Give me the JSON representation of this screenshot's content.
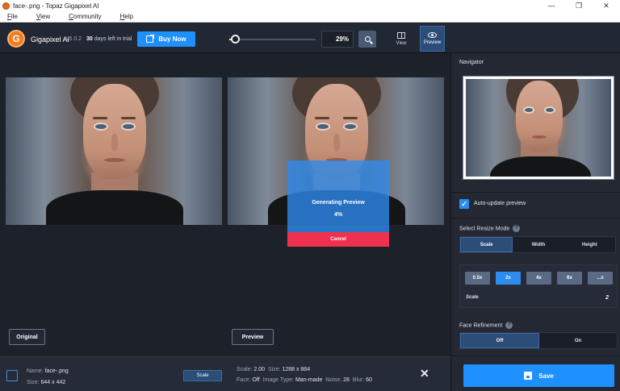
{
  "window": {
    "title": "face-.png - Topaz Gigapixel AI",
    "minimize": "—",
    "maximize": "❐",
    "close": "✕"
  },
  "menu": [
    "File",
    "View",
    "Community",
    "Help"
  ],
  "topbar": {
    "app_name": "Gigapixel AI",
    "version": "v5.0.2",
    "trial_days": "30",
    "trial_text": "days left in trial",
    "buy_label": "Buy Now",
    "zoom_value": "29%",
    "zoom_level": 0.29,
    "view_label": "View",
    "preview_label": "Preview"
  },
  "main": {
    "generating_label": "Generating Preview",
    "progress_text": "4%",
    "cancel_label": "Cancel",
    "original_label": "Original",
    "preview_label": "Preview"
  },
  "bottom": {
    "name_label": "Name:",
    "name_value": "face-.png",
    "size_label": "Size:",
    "size_value": "644 x 442",
    "mode_chip": "Scale",
    "scale_label": "Scale:",
    "scale_value": "2.00",
    "out_size_label": "Size:",
    "out_size_value": "1288 x 884",
    "face_label": "Face:",
    "face_value": "Off",
    "image_type_label": "Image Type:",
    "image_type_value": "Man-made",
    "noise_label": "Noise:",
    "noise_value": "28",
    "blur_label": "Blur:",
    "blur_value": "60",
    "close_icon": "✕"
  },
  "sidebar": {
    "navigator_title": "Navigator",
    "auto_update_label": "Auto-update preview",
    "auto_update_checked": true,
    "resize_mode_title": "Select Resize Mode",
    "resize_modes": [
      "Scale",
      "Width",
      "Height"
    ],
    "resize_mode_active": "Scale",
    "scale_options": [
      "0.5x",
      "2x",
      "4x",
      "6x",
      "...x"
    ],
    "scale_active": "2x",
    "scale_label": "Scale",
    "scale_value": "2",
    "face_refinement_title": "Face Refinement",
    "face_options": [
      "Off",
      "On"
    ],
    "face_active": "Off",
    "save_label": "Save"
  },
  "colors": {
    "accent": "#1e90ff",
    "cancel": "#f0304f",
    "active_segment": "#2b4d78"
  }
}
